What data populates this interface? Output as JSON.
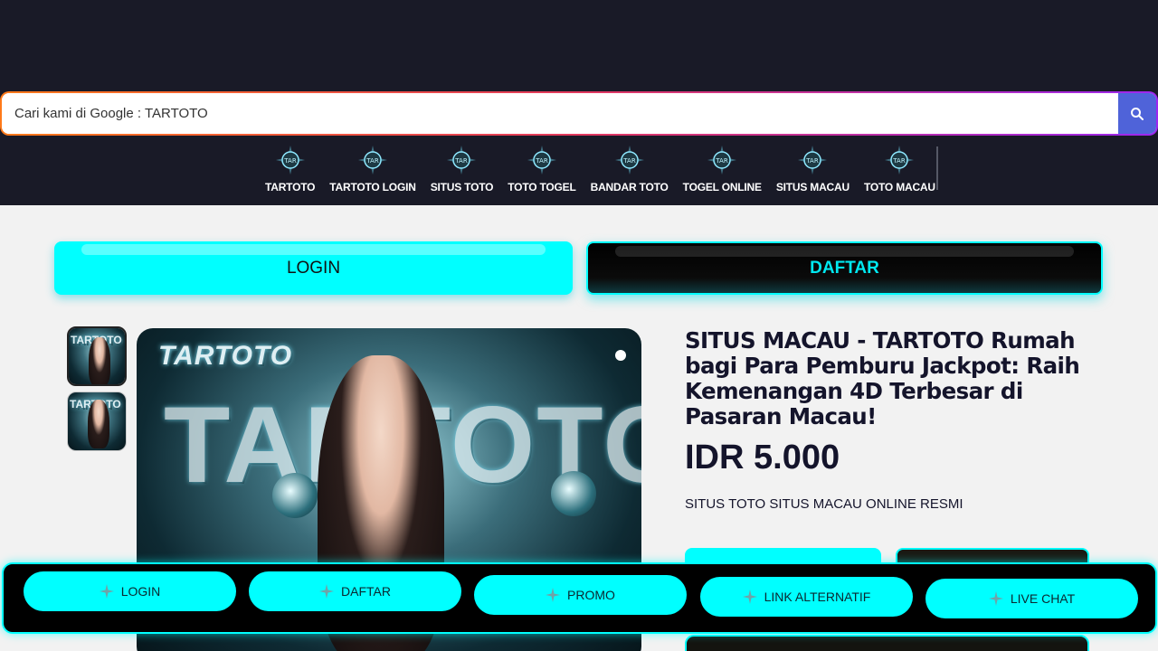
{
  "search": {
    "placeholder": "Cari kami di Google : TARTOTO",
    "value": "",
    "accent_colors": [
      "#ff7a1a",
      "#e2395e",
      "#9c27f0"
    ],
    "button_color": "#4f63d9",
    "button_icon": "search-icon"
  },
  "nav": {
    "icon": "tar-compass-logo-icon",
    "items": [
      {
        "label": "TARTOTO"
      },
      {
        "label": "TARTOTO LOGIN"
      },
      {
        "label": "SITUS TOTO"
      },
      {
        "label": "TOTO TOGEL"
      },
      {
        "label": "BANDAR TOTO"
      },
      {
        "label": "TOGEL ONLINE"
      },
      {
        "label": "SITUS MACAU"
      },
      {
        "label": "TOTO MACAU"
      }
    ]
  },
  "actions": {
    "login_label": "LOGIN",
    "daftar_label": "DAFTAR",
    "accent": "#00ffff"
  },
  "gallery": {
    "image_text": "TARTOTO",
    "thumbnail_count": 2,
    "active_thumbnail": 0
  },
  "product": {
    "title": "SITUS MACAU - TARTOTO Rumah bagi Para Pemburu Jackpot: Raih Kemenangan 4D Terbesar di Pasaran Macau!",
    "price": "IDR 5.000",
    "description": "SITUS TOTO SITUS MACAU ONLINE RESMI"
  },
  "bottom_bar": {
    "icon": "sparkle-icon",
    "items": [
      {
        "label": "LOGIN"
      },
      {
        "label": "DAFTAR"
      },
      {
        "label": "PROMO"
      },
      {
        "label": "LINK ALTERNATIF"
      },
      {
        "label": "LIVE CHAT"
      }
    ]
  },
  "colors": {
    "header_bg": "#191a27",
    "page_bg": "#f2f2f2",
    "text_dark": "#14142b"
  }
}
